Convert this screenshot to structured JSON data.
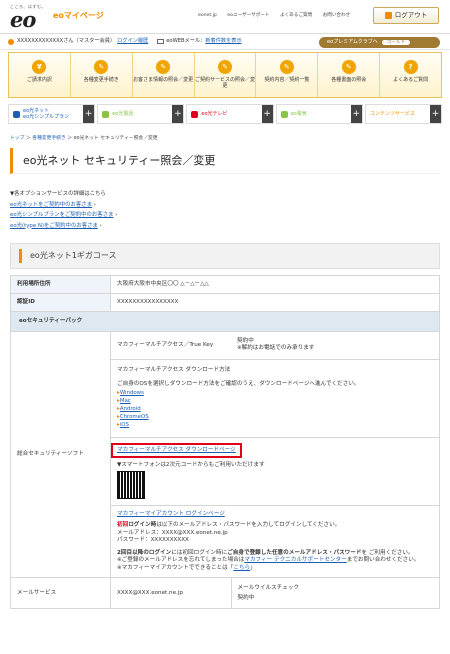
{
  "header": {
    "tagline": "こころ、はずむ。",
    "logo": "eo",
    "mypage": "eoマイページ",
    "links": [
      "eonet.jp",
      "eoユーザーサポート",
      "よくあるご質問",
      "お問い合わせ"
    ],
    "logout": "ログアウト"
  },
  "userbar": {
    "user": "XXXXXXXXXXXXXさん（マスター会員）",
    "login_history": "ログイン履歴",
    "webmail_prefix": "eoWEBメール：",
    "webmail_link": "新着件数を表示",
    "premium": "eoプレミアムクラブへ",
    "premium_rank": "ゴールド"
  },
  "gnav": [
    {
      "icon": "¥",
      "label": "ご請求内訳"
    },
    {
      "icon": "✎",
      "label": "各種変更手続き"
    },
    {
      "icon": "✎",
      "label": "お客さま情報の照会／変更"
    },
    {
      "icon": "✎",
      "label": "ご契約サービスの照会／変更"
    },
    {
      "icon": "✎",
      "label": "契約内容／契約一覧"
    },
    {
      "icon": "✎",
      "label": "各種書面の照会"
    },
    {
      "icon": "?",
      "label": "よくあるご質問"
    }
  ],
  "snav": [
    {
      "label": "eo光ネット\neo光シンプルプラン",
      "color": "#1a5fb4"
    },
    {
      "label": "eo光電話",
      "color": "#8bc34a"
    },
    {
      "label": "eo光テレビ",
      "color": "#e0001b"
    },
    {
      "label": "eo電気",
      "color": "#8bc34a"
    },
    {
      "label": "コンテンツサービス",
      "color": "#f08c00"
    }
  ],
  "breadcrumb": [
    "トップ",
    "各種変更手続き",
    "eo光ネット セキュリティー照会／変更"
  ],
  "page_title": "eo光ネット セキュリティー照会／変更",
  "options": {
    "heading": "▼各オプションサービスの詳細はこちら",
    "links": [
      "eo光ネットをご契約中のお客さま",
      "eo光シンプルプランをご契約中のお客さま",
      "eo光(type N)をご契約中のお客さま"
    ]
  },
  "course": "eo光ネット1ギガコース",
  "rows": {
    "address_label": "利用場所住所",
    "address_value": "大阪府大阪市中央区〇〇 △－△－△△",
    "id_label": "認証ID",
    "id_value": "XXXXXXXXXXXXXXXX",
    "pack_label": "eoセキュリティーパック",
    "soft_label": "総合セキュリティーソフト",
    "mail_label": "メールサービス",
    "mail_value": "XXXX@XXX.eonet.ne.jp"
  },
  "soft": {
    "truekey": "マカフィーマルチアクセス／True Key",
    "truekey_status": "契約中",
    "truekey_note": "※解約はお電話でのみ承ります",
    "download_title": "マカフィーマルチアクセス ダウンロード方法",
    "download_desc": "ご自身のOSを選択しダウンロード方法をご確認のうえ、ダウンロードページへ進んでください。",
    "os": [
      "Windows",
      "Mac",
      "Android",
      "ChromeOS",
      "iOS"
    ],
    "download_link": "マカフィーマルチアクセス ダウンロードページ",
    "qr_note": "▼スマートフォンは2次元コードからもご利用いただけます",
    "account_link": "マカフィーマイアカウント ログインページ",
    "first_tag": "初回",
    "first_bold": "ログイン時",
    "first_text": "は以下のメールアドレス・パスワードを入力してログインしてください。",
    "mail_line": "メールアドレス：XXXX@XXX.eonet.ne.jp",
    "pw_line": "パスワード：XXXXXXXXXX",
    "second_bold": "2回目以降のログイン",
    "second_text": "には初回ログイン時に",
    "second_bold2": "ご自身で登録した任意のメールアドレス・パスワード",
    "second_tail": "を ご利用ください。",
    "forgot_text": "※ご登録のメールアドレスを忘れてしまった場合は",
    "support_link": "マカフィー テクニカルサポートセンター",
    "forgot_tail": "までお問い合わせください。",
    "account_text": "※マカフィーマイアカウントでできることは「",
    "here": "こちら",
    "account_tail": "」"
  },
  "mail": {
    "virus": "メールウイルスチェック",
    "status": "契約中"
  }
}
